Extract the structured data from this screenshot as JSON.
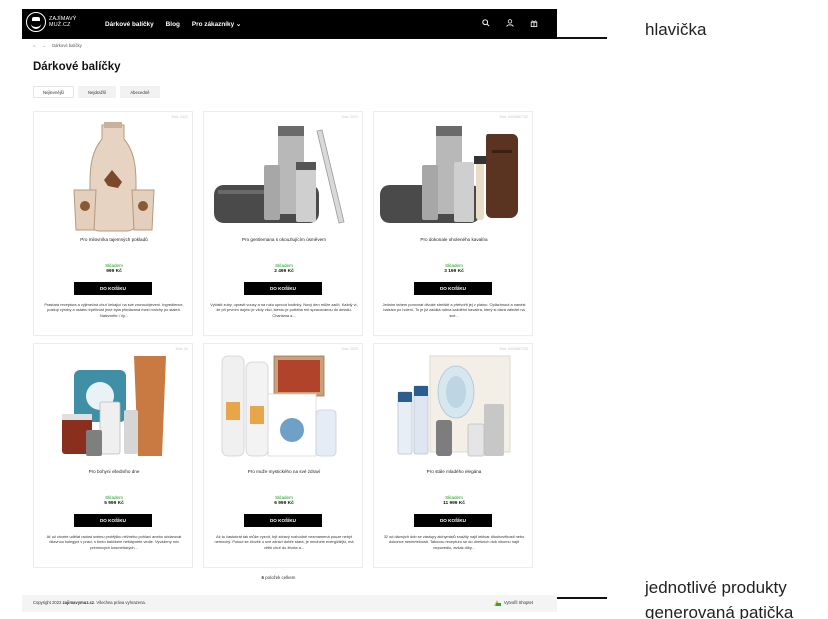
{
  "header": {
    "logo_text": "ZAJÍMAVÝ MUŽ.CZ",
    "nav": [
      "Dárkové balíčky",
      "Blog",
      "Pro zákazníky ⌄"
    ],
    "icons": [
      "search-icon",
      "user-icon",
      "gift-icon"
    ]
  },
  "breadcrumb": {
    "home_icon": "⌂",
    "separator": "→",
    "current": "Dárkové balíčky"
  },
  "page_title": "Dárkové balíčky",
  "sort": [
    "Nejlevnější",
    "Nejdražší",
    "Abecedně"
  ],
  "products": [
    {
      "code": "Kód: 2023",
      "name": "Pro milovníka tajemných pokladů",
      "stock": "Skladem",
      "price": "999 Kč",
      "button": "DO KOŠÍKU",
      "desc": "Prastará receptura a výjimečná chuť čekající na své znovuobjevení. Ingredience, postup výroby a ostatní trpělivost jené byla předávaná mezi mnichy po staletí. Nalezněte i Vy..."
    },
    {
      "code": "Kód: 2021",
      "name": "Pro gentlemana s okouzlujícím úsměvem",
      "stock": "Skladem",
      "price": "2 499 Kč",
      "button": "DO KOŠÍKU",
      "desc": "Vyčistit zuby, upravit vousy a na ruku upnout hodinky. Nový den může začít. Každý ví, že při prvním dojmu je vždy vkci, kterou je potřeba mít spracovanou do detailu. Charisma a..."
    },
    {
      "code": "Kód: 0000667742",
      "name": "Pro dokonale oholeného kavalíra",
      "stock": "Skladem",
      "price": "3 199 Kč",
      "button": "DO KOŠÍKU",
      "desc": "Jedním tahem porovnat divoké strniště a přetvořit jej v plaínu. Opláchnout a nanést balzám po holení. To je již začátá rutina každého kavalíra, který si dává záležet na své..."
    },
    {
      "code": "Kód: 24",
      "name": "Pro bohyni všedního dne",
      "stock": "Skladem",
      "price": "5 999 Kč",
      "button": "DO KOŠÍKU",
      "desc": "Ať už chcete udělat radost svému protějšku něžného pohlaví anebo obdarovat útlavnou kolegyni v práci, s tímto balíčkem nešlápnete vedle. Vyváženy mix prémiových kosmetických..."
    },
    {
      "code": "Kód: 2023",
      "name": "Pro muže mystického na své zdraví",
      "stock": "Skladem",
      "price": "6 999 Kč",
      "button": "DO KOŠÍKU",
      "desc": "Až to častokrát tak může vyznít, být zdravý rozhodně nezmamená pouze nebýt nemocný. Pokud se člověk o své zdraví dobře stará, je mnohem energičtější, má větší chuť do života a..."
    },
    {
      "code": "Kód: 0000667763",
      "name": "Pro stále mladého elegána",
      "stock": "Skladem",
      "price": "11 999 Kč",
      "button": "DO KOŠÍKU",
      "desc": "32 od dávných dob se zástupy alchymistů snažily najít lektvar dlouhověkosti nebo dokonce nesmrtelnosti. Takovou recepturu se do dnešních dob nikomu najít nepovedlo, avšak díky..."
    }
  ],
  "count": {
    "number": "6",
    "text": " položek celkem"
  },
  "footer": {
    "copyright_prefix": "Copyright 2022 ",
    "copyright_site": "zajimavymuz.cz",
    "copyright_suffix": ". Všechna práva vyhrazena.",
    "shoptet": "Vytvořil Shoptet"
  },
  "annotations": {
    "header": "hlavička",
    "products": "jednotlivé produkty",
    "footer": "generovaná patička"
  }
}
